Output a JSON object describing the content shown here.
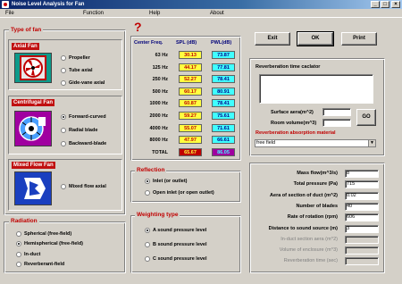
{
  "window": {
    "title": "Noise Level Analysis for Fan",
    "minimize": "_",
    "maximize": "□",
    "close": "×"
  },
  "menu": [
    "File",
    "Function",
    "Help",
    "About"
  ],
  "type_of_fan": {
    "title": "Type of  fan",
    "axial": {
      "title": "Axial Fan",
      "options": [
        "Propeller",
        "Tube axial",
        "Gide-vane axial"
      ]
    },
    "centrifugal": {
      "title": "Centrifugal Fan",
      "options": [
        "Forward-curved",
        "Radial blade",
        "Backward-blade"
      ],
      "selected": "Forward-curved"
    },
    "mixed": {
      "title": "Mixed Flow Fan",
      "options": [
        "Mixed flow axial"
      ]
    }
  },
  "radiation": {
    "title": "Radiation",
    "options": [
      "Spherical (free-field)",
      "Hemispherical (free-field)",
      "In-duct",
      "Reverberant-field"
    ],
    "selected": "Hemispherical (free-field)"
  },
  "spectrum": {
    "help_mark": "?",
    "headers": [
      "Center Freq.",
      "SPL (dB)",
      "PWL(dB)"
    ],
    "rows": [
      {
        "freq": "63 Hz",
        "spl": "30.13",
        "pwl": "73.87"
      },
      {
        "freq": "125 Hz",
        "spl": "44.17",
        "pwl": "77.81"
      },
      {
        "freq": "250 Hz",
        "spl": "52.27",
        "pwl": "78.41"
      },
      {
        "freq": "500 Hz",
        "spl": "60.17",
        "pwl": "80.91"
      },
      {
        "freq": "1000 Hz",
        "spl": "60.87",
        "pwl": "78.41"
      },
      {
        "freq": "2000 Hz",
        "spl": "59.27",
        "pwl": "75.61"
      },
      {
        "freq": "4000 Hz",
        "spl": "55.07",
        "pwl": "71.61"
      },
      {
        "freq": "8000 Hz",
        "spl": "47.97",
        "pwl": "66.61"
      }
    ],
    "total": {
      "label": "TOTAL",
      "spl": "65.67",
      "pwl": "86.05"
    }
  },
  "reflection": {
    "title": "Reflection",
    "options": [
      "Inlet (or outlet)",
      "Open inlet (or open outlet)"
    ],
    "selected": "Inlet (or outlet)"
  },
  "weighting": {
    "title": "Weighting type",
    "options": [
      "A sound pressure level",
      "B sound pressure level",
      "C sound pressure level"
    ],
    "selected": "A sound pressure level"
  },
  "buttons": {
    "exit": "Exit",
    "ok": "OK",
    "print": "Print",
    "go": "GO"
  },
  "reverb": {
    "title": "Reverberation time caclator",
    "surface_label": "Surface aera(m^2)",
    "volume_label": "Room volume(m^3)",
    "absorption_label": "Reverberation absorption material",
    "absorption_value": "free field"
  },
  "params": [
    {
      "label": "Mass flow(m^3/s)",
      "value": "8",
      "enabled": true
    },
    {
      "label": "Total pressure (Pa)",
      "value": "715",
      "enabled": true
    },
    {
      "label": "Aera of section of duct (m^2)",
      "value": "0.02",
      "enabled": true
    },
    {
      "label": "Number of blades",
      "value": "40",
      "enabled": true
    },
    {
      "label": "Rate of rotation (rpm)",
      "value": "606",
      "enabled": true
    },
    {
      "label": "Distance to sound source (m)",
      "value": "3",
      "enabled": true
    },
    {
      "label": "In-duct section aera (m^2)",
      "value": "",
      "enabled": false
    },
    {
      "label": "Volume of enclosure (m^3)",
      "value": "",
      "enabled": false
    },
    {
      "label": "Reverberation time (sec)",
      "value": "",
      "enabled": false
    }
  ],
  "colors": {
    "accent_red": "#c00000",
    "spl_bg": "#ffff40",
    "pwl_bg": "#40ffff",
    "title_bar": "#0a246a"
  }
}
